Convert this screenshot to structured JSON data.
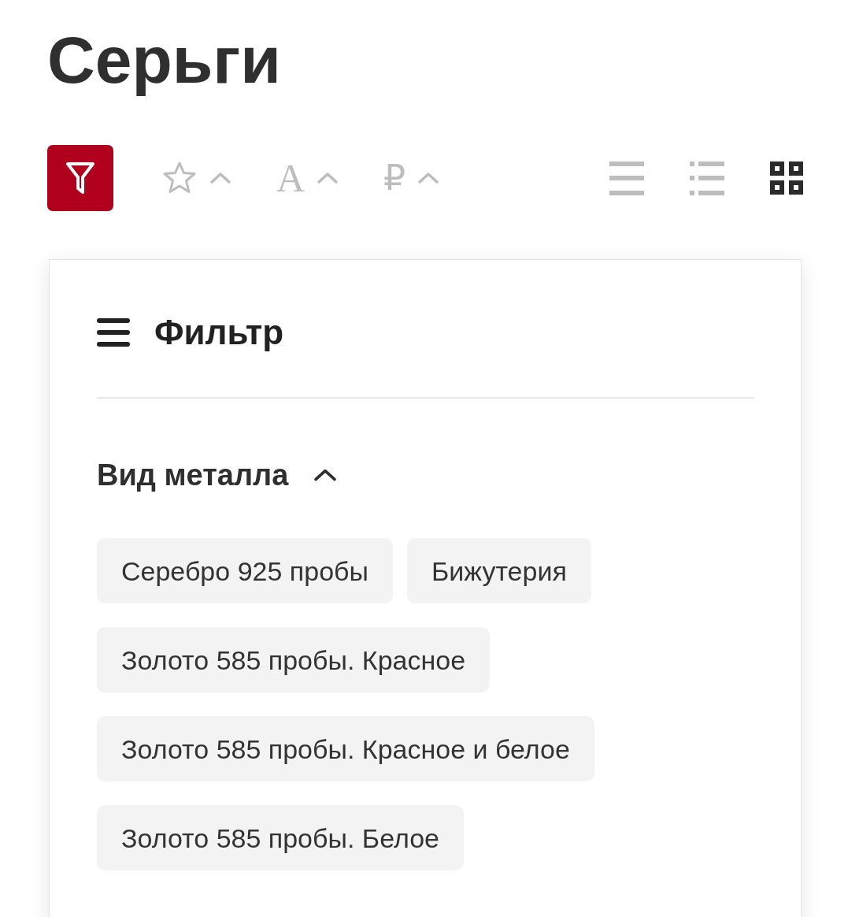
{
  "page": {
    "title": "Серьги"
  },
  "toolbar": {
    "filter_button": {
      "active": true
    },
    "sort_options": [
      {
        "kind": "rating"
      },
      {
        "kind": "name",
        "symbol": "A"
      },
      {
        "kind": "price",
        "symbol": "₽"
      }
    ],
    "view_modes": [
      {
        "kind": "list",
        "selected": false
      },
      {
        "kind": "detailed-list",
        "selected": false
      },
      {
        "kind": "grid",
        "selected": true
      }
    ]
  },
  "filter_panel": {
    "title": "Фильтр",
    "sections": [
      {
        "title": "Вид металла",
        "expanded": true,
        "options": [
          {
            "label": "Серебро 925 пробы",
            "selected": false
          },
          {
            "label": "Бижутерия",
            "selected": false
          },
          {
            "label": "Золото 585 пробы. Красное",
            "selected": false
          },
          {
            "label": "Золото 585 пробы. Красное и белое",
            "selected": false
          },
          {
            "label": "Золото 585 пробы. Белое",
            "selected": false
          }
        ]
      }
    ]
  }
}
